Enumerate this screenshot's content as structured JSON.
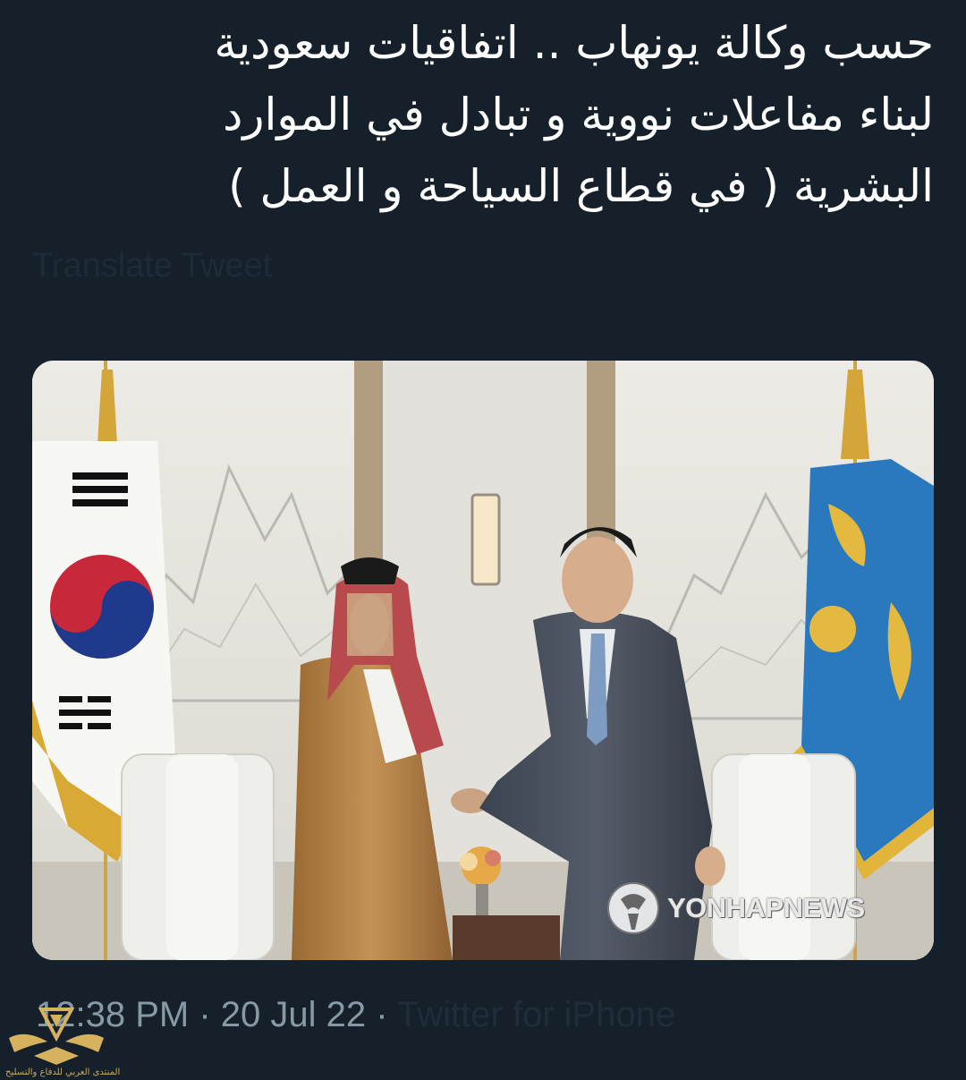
{
  "tweet": {
    "text": "حسب وكالة يونهاب .. اتفاقيات سعودية\nلبناء مفاعلات نووية و تبادل في الموارد\nالبشرية ( في قطاع السياحة و العمل )",
    "translate_label": "Translate Tweet"
  },
  "photo": {
    "watermark": "YONHAPNEWS",
    "description_icon": "photo-image"
  },
  "meta": {
    "time": "12:38 PM",
    "date": "20 Jul 22",
    "source": "Twitter for iPhone"
  },
  "forum_watermark": {
    "text": "المنتدى العربي للدفاع والتسليح"
  },
  "colors": {
    "background": "#15202b",
    "text": "#ffffff",
    "meta": "#8899a6"
  }
}
